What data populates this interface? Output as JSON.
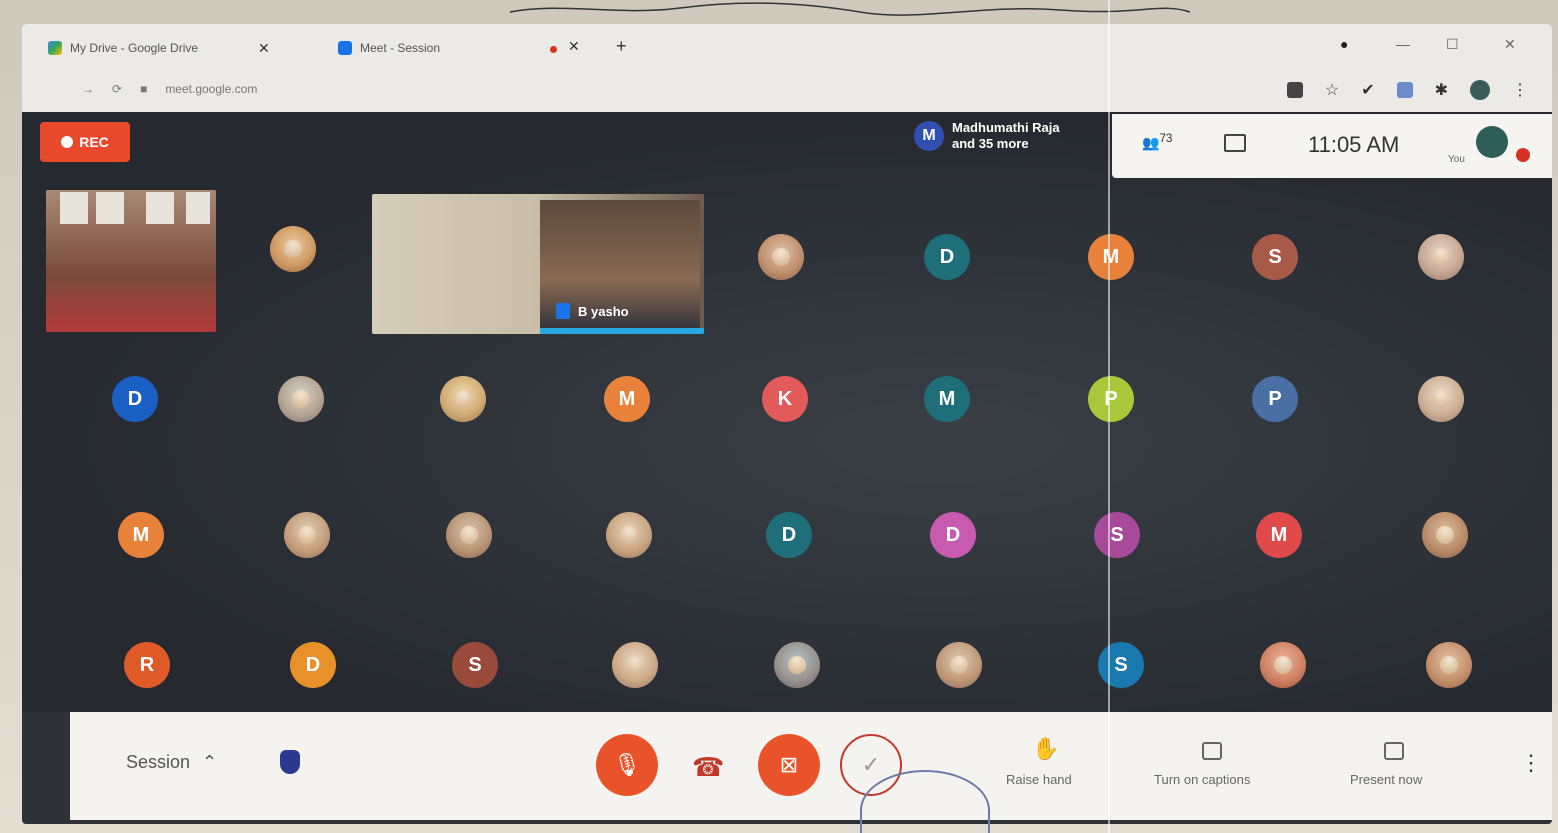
{
  "browser": {
    "tab1_title": "My Drive - Google Drive",
    "tab2_title": "Meet - Session",
    "new_tab": "+",
    "url": "meet.google.com"
  },
  "meet": {
    "rec_label": "REC",
    "speaker_initial": "M",
    "speaker_name": "Madhumathi Raja",
    "speaker_more": "and 35 more",
    "people_count": "73",
    "time": "11:05 AM",
    "you_label": "You",
    "video_name": "B yasho"
  },
  "avatars": [
    {
      "letter": "",
      "color": "#e0923a"
    },
    {
      "letter": "",
      "color": "#b0785a"
    },
    {
      "letter": "D",
      "color": "#1e6f7a"
    },
    {
      "letter": "M",
      "color": "#e8823a"
    },
    {
      "letter": "S",
      "color": "#a85a48"
    },
    {
      "letter": "",
      "color": "#c9b9ca"
    },
    {
      "letter": "D",
      "color": "#1a5fc4"
    },
    {
      "letter": "",
      "color": "#8fb0c8"
    },
    {
      "letter": "",
      "color": "#e7c66a"
    },
    {
      "letter": "M",
      "color": "#e8823a"
    },
    {
      "letter": "K",
      "color": "#e35a5a"
    },
    {
      "letter": "M",
      "color": "#1e6f7a"
    },
    {
      "letter": "P",
      "color": "#a8c83a"
    },
    {
      "letter": "P",
      "color": "#4a6fa5"
    },
    {
      "letter": "",
      "color": "#d8d0c8"
    },
    {
      "letter": "M",
      "color": "#e8823a"
    },
    {
      "letter": "",
      "color": "#c0a080"
    },
    {
      "letter": "",
      "color": "#a08070"
    },
    {
      "letter": "",
      "color": "#d0b090"
    },
    {
      "letter": "D",
      "color": "#1e6f7a"
    },
    {
      "letter": "D",
      "color": "#c85ab0"
    },
    {
      "letter": "S",
      "color": "#a84a9a"
    },
    {
      "letter": "M",
      "color": "#e04a4a"
    },
    {
      "letter": "",
      "color": "#a06848"
    },
    {
      "letter": "R",
      "color": "#e05a28"
    },
    {
      "letter": "D",
      "color": "#e8902a"
    },
    {
      "letter": "S",
      "color": "#9a4a3a"
    },
    {
      "letter": "",
      "color": "#d8c0a8"
    },
    {
      "letter": "",
      "color": "#3a7ab8"
    },
    {
      "letter": "",
      "color": "#b09078"
    },
    {
      "letter": "S",
      "color": "#1a7ab0"
    },
    {
      "letter": "",
      "color": "#e04a3a"
    },
    {
      "letter": "",
      "color": "#c07858"
    }
  ],
  "controls": {
    "session_label": "Session",
    "raise_hand": "Raise hand",
    "captions": "Turn on captions",
    "present": "Present now"
  }
}
